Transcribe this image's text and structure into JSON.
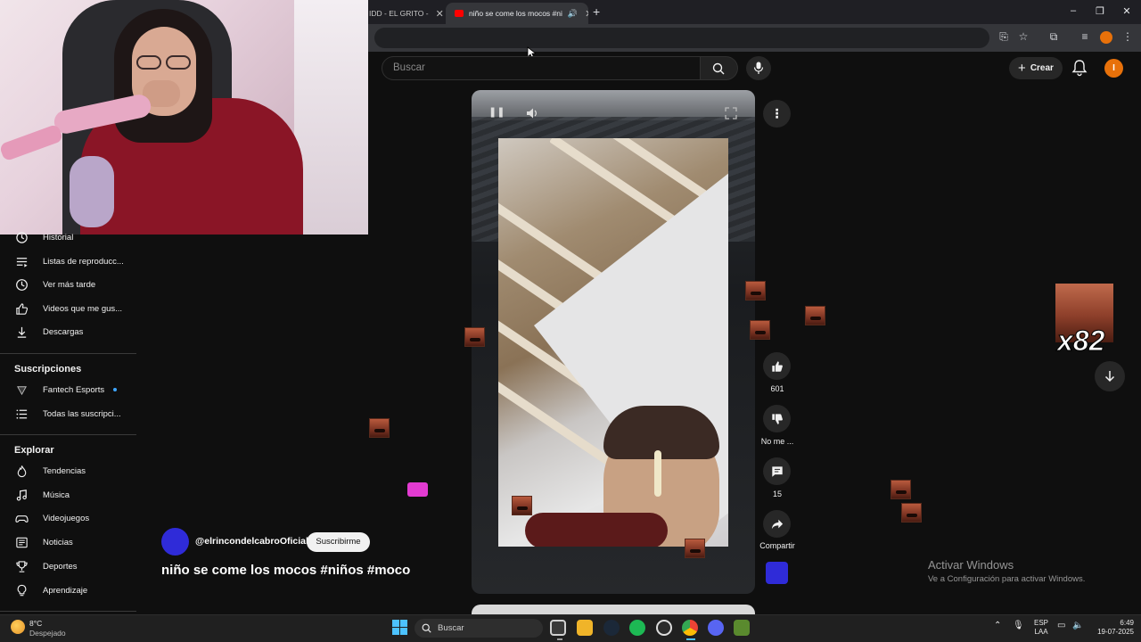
{
  "browser": {
    "tabs": [
      {
        "title": "IDD - EL GRITO -",
        "active": false
      },
      {
        "title": "niño se come los mocos #ni",
        "active": true
      }
    ]
  },
  "youtube": {
    "search_placeholder": "Buscar",
    "create_label": "Crear",
    "avatar_initial": "I"
  },
  "sidebar": {
    "you_items": [
      {
        "label": "Historial",
        "icon": "history-icon"
      },
      {
        "label": "Listas de reproducc...",
        "icon": "playlist-icon"
      },
      {
        "label": "Ver más tarde",
        "icon": "clock-icon"
      },
      {
        "label": "Videos que me gus...",
        "icon": "thumb-up-icon"
      },
      {
        "label": "Descargas",
        "icon": "download-icon"
      }
    ],
    "subscriptions_heading": "Suscripciones",
    "subscriptions": [
      {
        "label": "Fantech Esports",
        "icon": "channel-avatar-icon",
        "new": true
      },
      {
        "label": "Todas las suscripci...",
        "icon": "list-icon"
      }
    ],
    "explore_heading": "Explorar",
    "explore_items": [
      {
        "label": "Tendencias",
        "icon": "fire-icon"
      },
      {
        "label": "Música",
        "icon": "music-icon"
      },
      {
        "label": "Videojuegos",
        "icon": "gamepad-icon"
      },
      {
        "label": "Noticias",
        "icon": "news-icon"
      },
      {
        "label": "Deportes",
        "icon": "trophy-icon"
      },
      {
        "label": "Aprendizaje",
        "icon": "bulb-icon"
      }
    ]
  },
  "short": {
    "channel": "@elrincondelcabroOficial",
    "subscribe_label": "Suscribirme",
    "title": "niño se come los mocos #niños #moco",
    "likes": "601",
    "dislike_label": "No me ...",
    "comments": "15",
    "share_label": "Compartir"
  },
  "overlay": {
    "combo": "x82"
  },
  "watermark": {
    "line1": "Activar Windows",
    "line2": "Ve a Configuración para activar Windows."
  },
  "taskbar": {
    "weather_temp": "8°C",
    "weather_desc": "Despejado",
    "search_label": "Buscar",
    "lang_line1": "ESP",
    "lang_line2": "LAA",
    "time": "6:49",
    "date": "19-07-2025"
  }
}
